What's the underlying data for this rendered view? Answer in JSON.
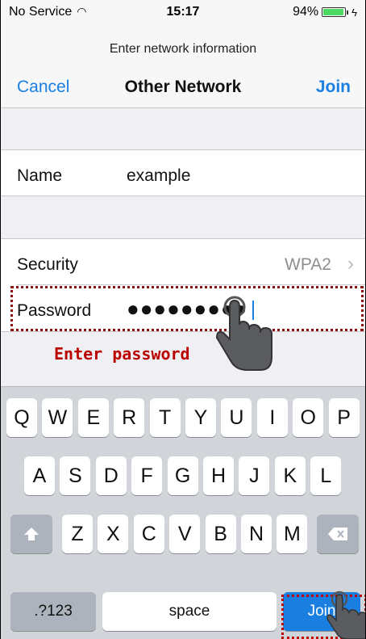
{
  "status_bar": {
    "carrier": "No Service",
    "time": "15:17",
    "battery": "94%",
    "battery_level": 0.94
  },
  "nav": {
    "prompt": "Enter network information",
    "cancel_label": "Cancel",
    "title": "Other Network",
    "join_label": "Join"
  },
  "form": {
    "name_label": "Name",
    "name_value": "example",
    "security_label": "Security",
    "security_value": "WPA2",
    "password_label": "Password",
    "password_value": "●●●●●●●●●"
  },
  "annotation": {
    "hint": "Enter password"
  },
  "keyboard": {
    "row1": [
      "Q",
      "W",
      "E",
      "R",
      "T",
      "Y",
      "U",
      "I",
      "O",
      "P"
    ],
    "row2": [
      "A",
      "S",
      "D",
      "F",
      "G",
      "H",
      "J",
      "K",
      "L"
    ],
    "row3": [
      "Z",
      "X",
      "C",
      "V",
      "B",
      "N",
      "M"
    ],
    "numbers_label": ".?123",
    "space_label": "space",
    "join_label": "Join"
  },
  "colors": {
    "accent": "#1a7fe0",
    "annotation": "#b00000"
  }
}
